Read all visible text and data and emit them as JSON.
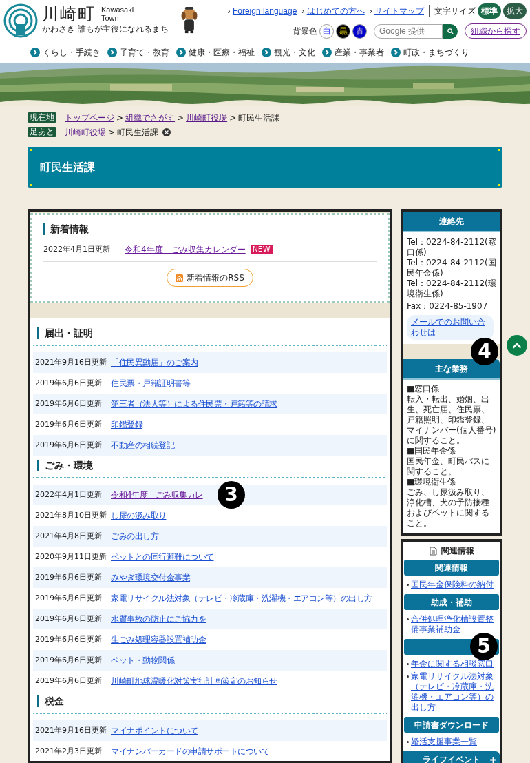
{
  "header": {
    "logo": {
      "title": "川崎町",
      "romaji": [
        "Kawasaki",
        "Town"
      ],
      "tagline": "かわさき 誰もが主役になれるまち"
    },
    "top_links": [
      {
        "arrow": "›",
        "label": "Foreign language"
      },
      {
        "arrow": "›",
        "label": "はじめての方へ"
      },
      {
        "arrow": "›",
        "label": "サイトマップ"
      }
    ],
    "font_size": {
      "label": "文字サイズ",
      "options": [
        {
          "label": "標準",
          "selected": true
        },
        {
          "label": "拡大",
          "selected": false
        }
      ]
    },
    "bg_color": {
      "label": "背景色",
      "options": [
        {
          "label": "白",
          "color": "#ffffff"
        },
        {
          "label": "黒",
          "color": "#000000"
        },
        {
          "label": "青",
          "color": "#0000cc"
        }
      ]
    },
    "search": {
      "placeholder": "Google 提供"
    },
    "org_button": "組織から探す",
    "nav": [
      "くらし・手続き",
      "子育て・教育",
      "健康・医療・福祉",
      "観光・文化",
      "産業・事業者",
      "町政・まちづくり"
    ]
  },
  "breadcrumbs": [
    {
      "badge": "現在地",
      "separator": ">",
      "items": [
        "トップページ",
        "組織でさがす",
        "川崎町役場",
        "町民生活課"
      ],
      "closable": false
    },
    {
      "badge": "足あと",
      "separator": ">",
      "items": [
        "川崎町役場",
        "町民生活課"
      ],
      "closable": true
    }
  ],
  "page_title": "町民生活課",
  "news": {
    "heading": "新着情報",
    "items": [
      {
        "date": "2022年4月1日更新",
        "link": "令和4年度　ごみ収集カレンダー",
        "badge": "NEW"
      }
    ],
    "rss": "新着情報のRSS"
  },
  "sections": [
    {
      "heading": "届出・証明",
      "rows": [
        {
          "date": "2021年9月16日更新",
          "link": "「住民異動届」のご案内"
        },
        {
          "date": "2019年6月6日更新",
          "link": "住民票・戸籍証明書等"
        },
        {
          "date": "2019年6月6日更新",
          "link": "第三者（法人等）による住民票・戸籍等の請求"
        },
        {
          "date": "2019年6月6日更新",
          "link": "印鑑登録"
        },
        {
          "date": "2019年6月6日更新",
          "link": "不動産の相続登記"
        }
      ]
    },
    {
      "heading": "ごみ・環境",
      "rows": [
        {
          "date": "2022年4月1日更新",
          "link": "令和4年度　ごみ収集カレ"
        },
        {
          "date": "2021年8月10日更新",
          "link": "し尿の汲み取り"
        },
        {
          "date": "2021年4月8日更新",
          "link": "ごみの出し方"
        },
        {
          "date": "2020年9月11日更新",
          "link": "ペットとの同行避難について"
        },
        {
          "date": "2019年6月6日更新",
          "link": "みやぎ環境交付金事業"
        },
        {
          "date": "2019年6月6日更新",
          "link": "家電リサイクル法対象（テレビ・冷蔵庫・洗濯機・エアコン等）の出し方"
        },
        {
          "date": "2019年6月6日更新",
          "link": "水質事故の防止にご協力を"
        },
        {
          "date": "2019年6月6日更新",
          "link": "生ごみ処理容器設置補助金"
        },
        {
          "date": "2019年6月6日更新",
          "link": "ペット・動物関係"
        },
        {
          "date": "2019年6月6日更新",
          "link": "川崎町地球温暖化対策実行計画策定のお知らせ"
        }
      ]
    },
    {
      "heading": "税金",
      "rows": [
        {
          "date": "2021年9月16日更新",
          "link": "マイナポイントについて"
        },
        {
          "date": "2021年2月3日更新",
          "link": "マイナンバーカードの申請サポートについて"
        }
      ]
    }
  ],
  "contact": {
    "heading": "連絡先",
    "lines": [
      "Tel：0224-84-2112(窓口係)",
      "Tel：0224-84-2112(国民年金係)",
      "Tel：0224-84-2112(環境衛生係)",
      "Fax：0224-85-1907"
    ],
    "mail_link": "メールでのお問い合わせは"
  },
  "duties": {
    "heading": "主な業務",
    "lines": [
      "■窓口係",
      "転入・転出、婚姻、出生、死亡届、住民票、戸籍照明、印鑑登録、マイナンバー(個人番号)に関すること。",
      "■国民年金係",
      "国民年金、町民バスに関すること。",
      "■環境衛生係",
      "ごみ、し尿汲み取り、浄化槽、犬の予防接種およびペットに関すること。"
    ]
  },
  "related": {
    "heading": "関連情報",
    "groups": [
      {
        "heading": "関連情報",
        "links": [
          "国民年金保険料の納付"
        ]
      },
      {
        "heading": "助成・補助",
        "links": [
          "合併処理浄化槽設置整備事業補助金"
        ]
      },
      {
        "links": [
          "年金に関する相談窓口",
          "家電リサイクル法対象（テレビ・冷蔵庫・洗濯機・エアコン等）の出し方"
        ]
      },
      {
        "heading": "申請書ダウンロード",
        "links": [
          "婚活支援事業一覧"
        ]
      }
    ]
  },
  "life_event": "ライフイベント",
  "callouts": [
    "3",
    "4",
    "5"
  ]
}
